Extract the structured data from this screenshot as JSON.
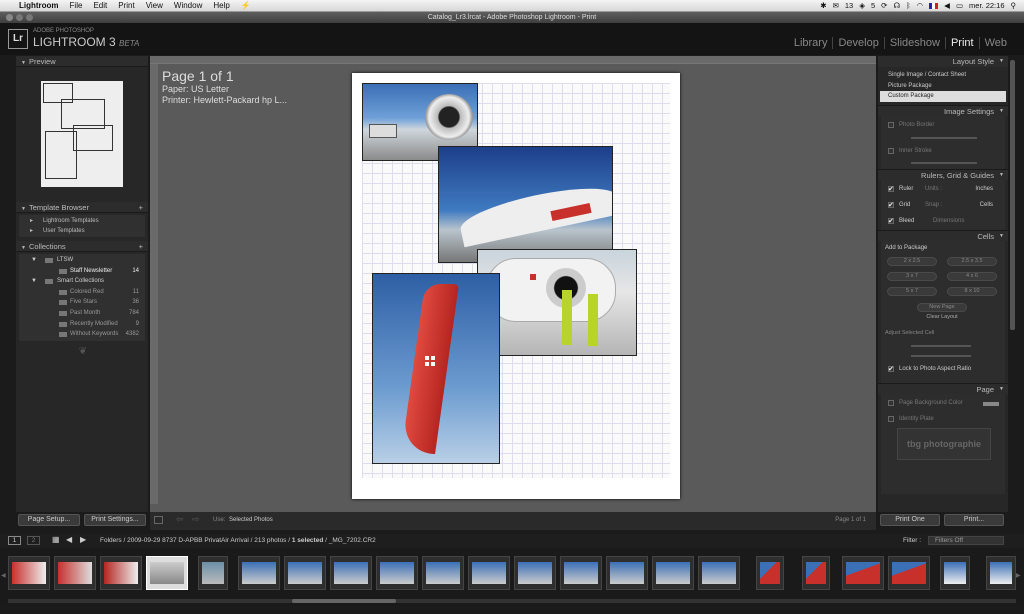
{
  "menubar": {
    "apple": "",
    "app": "Lightroom",
    "items": [
      "File",
      "Edit",
      "Print",
      "View",
      "Window",
      "Help"
    ],
    "extra": "⚡",
    "status": {
      "mail_count": "13",
      "dropbox_count": "5",
      "datetime": "mer. 22:16"
    }
  },
  "window": {
    "title": "Catalog_Lr3.lrcat - Adobe Photoshop Lightroom - Print"
  },
  "identity": {
    "logo": "Lr",
    "line1": "ADOBE PHOTOSHOP",
    "line2": "LIGHTROOM 3",
    "beta": "BETA"
  },
  "modules": [
    "Library",
    "Develop",
    "Slideshow",
    "Print",
    "Web"
  ],
  "active_module": "Print",
  "left": {
    "preview_title": "Preview",
    "template_browser": "Template Browser",
    "templates": [
      "Lightroom Templates",
      "User Templates"
    ],
    "collections_title": "Collections",
    "collections": [
      {
        "name": "LTSW",
        "count": ""
      },
      {
        "name": "Staff Newsletter",
        "count": "14"
      },
      {
        "name": "Smart Collections",
        "count": ""
      },
      {
        "name": "Colored Red",
        "count": "11"
      },
      {
        "name": "Five Stars",
        "count": "36"
      },
      {
        "name": "Past Month",
        "count": "784"
      },
      {
        "name": "Recently Modified",
        "count": "9"
      },
      {
        "name": "Without Keywords",
        "count": "4382"
      }
    ],
    "page_setup": "Page Setup...",
    "print_settings": "Print Settings..."
  },
  "center": {
    "page": "Page 1 of 1",
    "paper": "Paper:  US Letter",
    "printer": "Printer:  Hewlett-Packard hp L...",
    "toolbar_use_label": "Use:",
    "toolbar_use_value": "Selected Photos",
    "toolbar_page": "Page 1 of 1"
  },
  "right": {
    "layout_style": "Layout Style",
    "layout_options": [
      "Single Image / Contact Sheet",
      "Picture Package",
      "Custom Package"
    ],
    "selected_layout": "Custom Package",
    "image_settings": "Image Settings",
    "photo_border": "Photo Border",
    "inner_stroke": "Inner Stroke",
    "rulers_title": "Rulers, Grid & Guides",
    "ruler": "Ruler",
    "units_label": "Units :",
    "units_value": "Inches",
    "grid": "Grid",
    "snap_label": "Snap :",
    "snap_value": "Cells",
    "bleed": "Bleed",
    "dimensions": "Dimensions",
    "cells_title": "Cells",
    "add_to_package": "Add to Package",
    "cell_sizes": [
      "2 x 2.5",
      "2.5 x 3.5",
      "3 x 7",
      "4 x 6",
      "5 x 7",
      "8 x 10"
    ],
    "new_page": "New Page",
    "clear_layout": "Clear Layout",
    "adjust_cell": "Adjust Selected Cell",
    "lock_aspect": "Lock to Photo Aspect Ratio",
    "page_title": "Page",
    "page_bg": "Page Background Color",
    "identity_plate": "Identity Plate",
    "plate_text": "tbg photographie",
    "print_one": "Print One",
    "print": "Print..."
  },
  "filmstrip": {
    "pages": [
      "1",
      "2"
    ],
    "path_prefix": "Folders / 2009-09-29 8737 D-APBB PrivatAir Arrival / 213 photos /",
    "selected": "1 selected",
    "file": "/ _MG_7202.CR2",
    "filter_label": "Filter :",
    "filter_value": "Filters Off"
  },
  "colors": {
    "panel": "#272727",
    "bg": "#1b1b1b",
    "accent_red": "#c8302c",
    "sky": "#3b6fb6"
  }
}
